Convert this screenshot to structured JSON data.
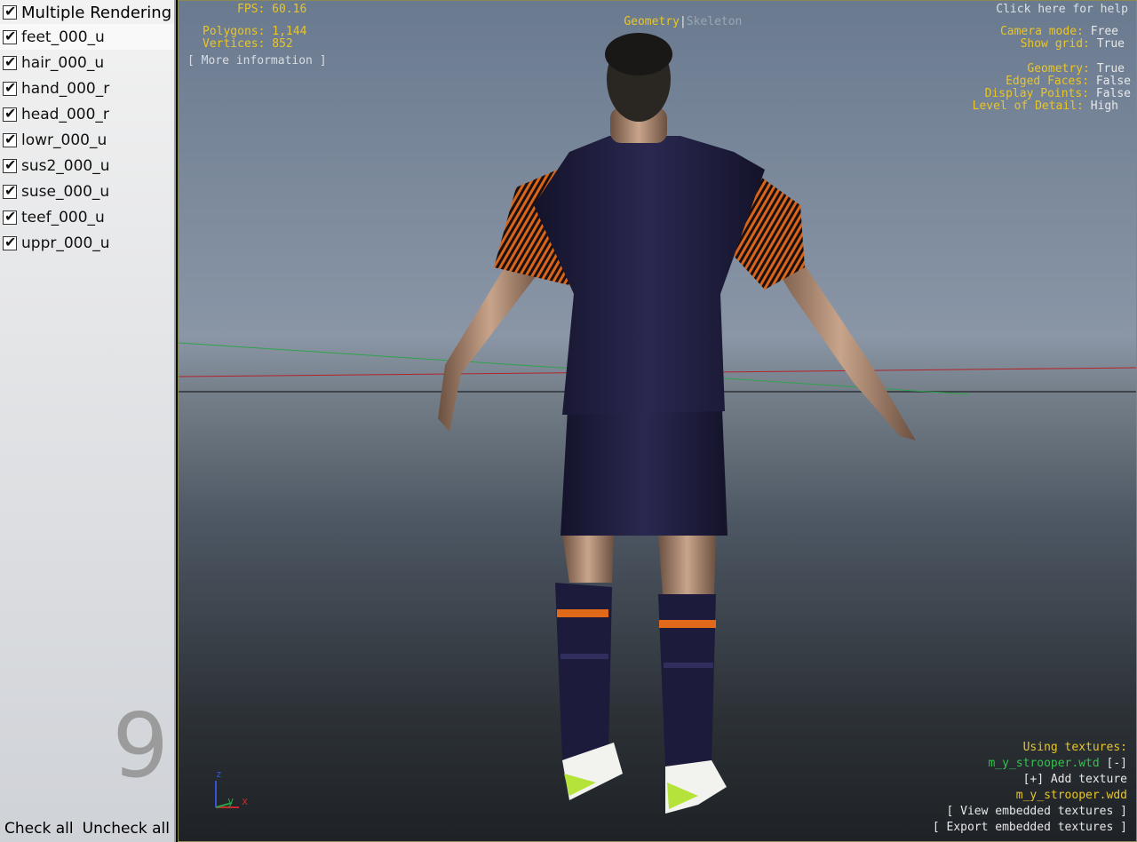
{
  "sidebar": {
    "multi_label": "Multiple Rendering",
    "items": [
      {
        "label": "feet_000_u",
        "checked": true
      },
      {
        "label": "hair_000_u",
        "checked": true
      },
      {
        "label": "hand_000_r",
        "checked": true
      },
      {
        "label": "head_000_r",
        "checked": true
      },
      {
        "label": "lowr_000_u",
        "checked": true
      },
      {
        "label": "sus2_000_u",
        "checked": true
      },
      {
        "label": "suse_000_u",
        "checked": true
      },
      {
        "label": "teef_000_u",
        "checked": true
      },
      {
        "label": "uppr_000_u",
        "checked": true
      }
    ],
    "count": "9",
    "check_all": "Check all",
    "uncheck_all": "Uncheck all"
  },
  "hud": {
    "fps_label": "FPS:",
    "fps_value": "60.16",
    "polygons_label": "Polygons:",
    "polygons_value": "1,144",
    "vertices_label": "Vertices:",
    "vertices_value": "852",
    "more_info": "[ More information ]",
    "mode_geometry": "Geometry",
    "mode_sep": "|",
    "mode_skeleton": "Skeleton",
    "help": "Click here for help",
    "camera_mode_label": "Camera mode:",
    "camera_mode_value": "Free",
    "show_grid_label": "Show grid:",
    "show_grid_value": "True",
    "geometry_label": "Geometry:",
    "geometry_value": "True",
    "edged_faces_label": "Edged Faces:",
    "edged_faces_value": "False",
    "display_points_label": "Display Points:",
    "display_points_value": "False",
    "lod_label": "Level of Detail:",
    "lod_value": "High",
    "using_textures": "Using textures:",
    "texture_file": "m_y_strooper.wtd",
    "remove_texture": "[-]",
    "add_texture": "[+] Add texture",
    "model_file": "m_y_strooper.wdd",
    "view_embedded": "[ View embedded textures ]",
    "export_embedded": "[ Export embedded textures ]"
  },
  "axes": {
    "z": "z",
    "y": "y",
    "x": "x"
  },
  "colors": {
    "hud_label": "#e8c52a",
    "hud_value": "#e8e8e8",
    "texture": "#33c24c",
    "kit_dark": "#1f1d3a",
    "kit_accent": "#e06a1a"
  }
}
